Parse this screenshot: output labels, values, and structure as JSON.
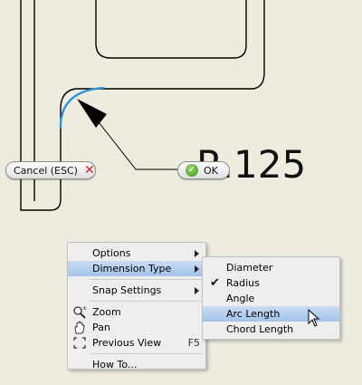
{
  "colors": {
    "canvas_bg": "#edecdf",
    "geometry_line": "#000000",
    "selected_arc": "#2a8fe0",
    "menu_highlight": "#b7d0ee",
    "cancel_icon": "#d42020",
    "ok_icon": "#4aa025"
  },
  "dimension": {
    "value_text": "R.125"
  },
  "buttons": {
    "cancel_label": "Cancel (ESC)",
    "cancel_icon": "close-icon",
    "ok_label": "OK",
    "ok_icon": "checkmark-icon"
  },
  "context_menu": {
    "options": "Options",
    "dimension_type": "Dimension Type",
    "snap_settings": "Snap Settings",
    "zoom": "Zoom",
    "pan": "Pan",
    "previous_view": "Previous View",
    "previous_view_shortcut": "F5",
    "how_to": "How To..."
  },
  "dimension_type_submenu": {
    "diameter": "Diameter",
    "radius": "Radius",
    "radius_checked": true,
    "angle": "Angle",
    "arc_length": "Arc Length",
    "arc_length_highlighted": true,
    "chord_length": "Chord Length"
  }
}
